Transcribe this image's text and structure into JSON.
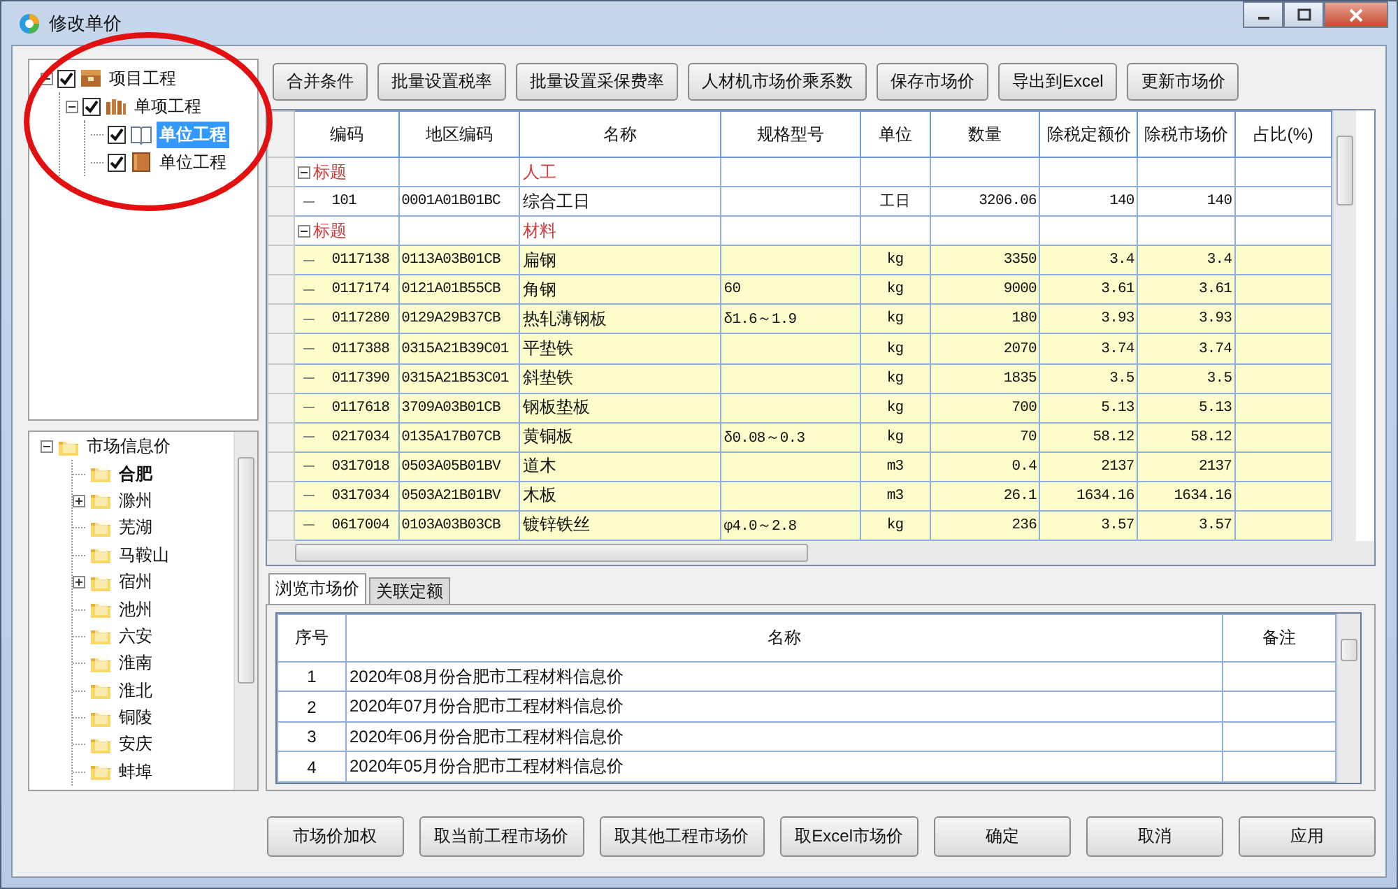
{
  "window": {
    "title": "修改单价"
  },
  "project_tree": [
    {
      "label": "项目工程",
      "kind": "project",
      "checked": true,
      "expanded": true,
      "selected": false,
      "children": [
        {
          "label": "单项工程",
          "kind": "subproject",
          "checked": true,
          "expanded": true,
          "selected": false,
          "children": [
            {
              "label": "单位工程",
              "kind": "unit",
              "checked": true,
              "selected": true
            },
            {
              "label": "单位工程",
              "kind": "unit",
              "checked": true,
              "selected": false
            }
          ]
        }
      ]
    }
  ],
  "market_tree": {
    "label": "市场信息价",
    "expanded": true,
    "children": [
      {
        "label": "合肥",
        "selected": true,
        "collapsed": false
      },
      {
        "label": "滁州",
        "selected": false,
        "collapsed": true
      },
      {
        "label": "芜湖",
        "selected": false,
        "collapsed": false
      },
      {
        "label": "马鞍山",
        "selected": false,
        "collapsed": false
      },
      {
        "label": "宿州",
        "selected": false,
        "collapsed": true
      },
      {
        "label": "池州",
        "selected": false,
        "collapsed": false
      },
      {
        "label": "六安",
        "selected": false,
        "collapsed": false
      },
      {
        "label": "淮南",
        "selected": false,
        "collapsed": false
      },
      {
        "label": "淮北",
        "selected": false,
        "collapsed": false
      },
      {
        "label": "铜陵",
        "selected": false,
        "collapsed": false
      },
      {
        "label": "安庆",
        "selected": false,
        "collapsed": false
      },
      {
        "label": "蚌埠",
        "selected": false,
        "collapsed": false
      }
    ]
  },
  "toolbar": [
    "合并条件",
    "批量设置税率",
    "批量设置采保费率",
    "人材机市场价乘系数",
    "保存市场价",
    "导出到Excel",
    "更新市场价"
  ],
  "price_table": {
    "columns": [
      "编码",
      "地区编码",
      "名称",
      "规格型号",
      "单位",
      "数量",
      "除税定额价",
      "除税市场价",
      "占比(%)"
    ],
    "rows": [
      {
        "kind": "title",
        "expanded": true,
        "code": "标题",
        "name": "人工"
      },
      {
        "kind": "item",
        "highlighted": false,
        "code": "101",
        "region_code": "0001A01B01BC",
        "name": "综合工日",
        "unit": "工日",
        "quantity": "3206.06",
        "quota_price": "140",
        "market_price": "140"
      },
      {
        "kind": "title",
        "expanded": true,
        "code": "标题",
        "name": "材料"
      },
      {
        "kind": "item",
        "highlighted": true,
        "code": "0117138",
        "region_code": "0113A03B01CB",
        "name": "扁钢",
        "unit": "kg",
        "quantity": "3350",
        "quota_price": "3.4",
        "market_price": "3.4"
      },
      {
        "kind": "item",
        "highlighted": true,
        "code": "0117174",
        "region_code": "0121A01B55CB",
        "name": "角钢",
        "spec": "60",
        "unit": "kg",
        "quantity": "9000",
        "quota_price": "3.61",
        "market_price": "3.61"
      },
      {
        "kind": "item",
        "highlighted": true,
        "code": "0117280",
        "region_code": "0129A29B37CB",
        "name": "热轧薄钢板",
        "spec": "δ1.6～1.9",
        "unit": "kg",
        "quantity": "180",
        "quota_price": "3.93",
        "market_price": "3.93"
      },
      {
        "kind": "item",
        "highlighted": true,
        "code": "0117388",
        "region_code": "0315A21B39C01",
        "name": "平垫铁",
        "unit": "kg",
        "quantity": "2070",
        "quota_price": "3.74",
        "market_price": "3.74"
      },
      {
        "kind": "item",
        "highlighted": true,
        "code": "0117390",
        "region_code": "0315A21B53C01",
        "name": "斜垫铁",
        "unit": "kg",
        "quantity": "1835",
        "quota_price": "3.5",
        "market_price": "3.5"
      },
      {
        "kind": "item",
        "highlighted": true,
        "code": "0117618",
        "region_code": "3709A03B01CB",
        "name": "钢板垫板",
        "unit": "kg",
        "quantity": "700",
        "quota_price": "5.13",
        "market_price": "5.13"
      },
      {
        "kind": "item",
        "highlighted": true,
        "code": "0217034",
        "region_code": "0135A17B07CB",
        "name": "黄铜板",
        "spec": "δ0.08～0.3",
        "unit": "kg",
        "quantity": "70",
        "quota_price": "58.12",
        "market_price": "58.12"
      },
      {
        "kind": "item",
        "highlighted": true,
        "code": "0317018",
        "region_code": "0503A05B01BV",
        "name": "道木",
        "unit": "m3",
        "quantity": "0.4",
        "quota_price": "2137",
        "market_price": "2137"
      },
      {
        "kind": "item",
        "highlighted": true,
        "code": "0317034",
        "region_code": "0503A21B01BV",
        "name": "木板",
        "unit": "m3",
        "quantity": "26.1",
        "quota_price": "1634.16",
        "market_price": "1634.16"
      },
      {
        "kind": "item",
        "highlighted": true,
        "code": "0617004",
        "region_code": "0103A03B03CB",
        "name": "镀锌铁丝",
        "spec": "φ4.0～2.8",
        "unit": "kg",
        "quantity": "236",
        "quota_price": "3.57",
        "market_price": "3.57"
      }
    ]
  },
  "tabs": [
    {
      "label": "浏览市场价",
      "selected": true
    },
    {
      "label": "关联定额",
      "selected": false
    }
  ],
  "price_list": {
    "columns": [
      "序号",
      "名称",
      "备注"
    ],
    "rows": [
      {
        "no": "1",
        "name": "2020年08月份合肥市工程材料信息价"
      },
      {
        "no": "2",
        "name": "2020年07月份合肥市工程材料信息价"
      },
      {
        "no": "3",
        "name": "2020年06月份合肥市工程材料信息价"
      },
      {
        "no": "4",
        "name": "2020年05月份合肥市工程材料信息价"
      }
    ]
  },
  "buttons": [
    "市场价加权",
    "取当前工程市场价",
    "取其他工程市场价",
    "取Excel市场价",
    "确定",
    "取消",
    "应用"
  ]
}
